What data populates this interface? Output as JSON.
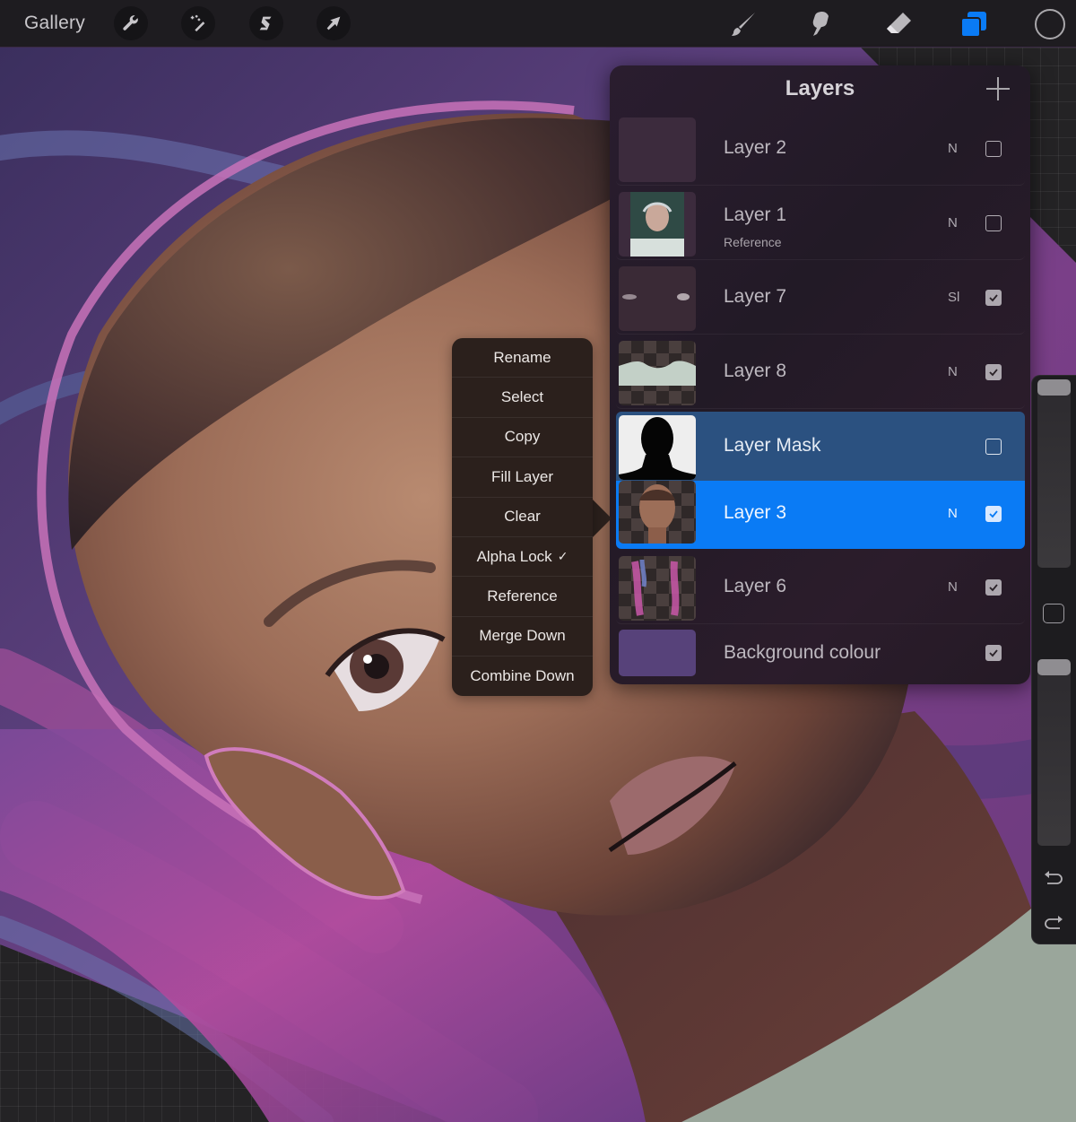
{
  "topbar": {
    "gallery_label": "Gallery",
    "left_tools": [
      {
        "name": "actions",
        "icon": "wrench-icon"
      },
      {
        "name": "adjustments",
        "icon": "magic-wand-icon"
      },
      {
        "name": "selection",
        "icon": "selection-s-icon"
      },
      {
        "name": "transform",
        "icon": "arrow-cursor-icon"
      }
    ],
    "right_tools": [
      {
        "name": "brush",
        "icon": "paintbrush-icon",
        "active": false
      },
      {
        "name": "smudge",
        "icon": "smudge-finger-icon",
        "active": false
      },
      {
        "name": "eraser",
        "icon": "eraser-icon",
        "active": false
      },
      {
        "name": "layers",
        "icon": "layers-icon",
        "active": true
      }
    ],
    "color_swatch": "#1e1c20"
  },
  "layers_panel": {
    "title": "Layers",
    "add_label": "+",
    "layers": [
      {
        "name": "Layer 2",
        "subtitle": "",
        "blend": "N",
        "visible": false,
        "thumb": "faint-face"
      },
      {
        "name": "Layer 1",
        "subtitle": "Reference",
        "blend": "N",
        "visible": false,
        "thumb": "photo"
      },
      {
        "name": "Layer 7",
        "subtitle": "",
        "blend": "Sl",
        "visible": true,
        "thumb": "highlights"
      },
      {
        "name": "Layer 8",
        "subtitle": "",
        "blend": "N",
        "visible": true,
        "thumb": "shirt"
      },
      {
        "name": "Layer Mask",
        "subtitle": "",
        "blend": "",
        "visible": false,
        "thumb": "mask"
      },
      {
        "name": "Layer 3",
        "subtitle": "",
        "blend": "N",
        "visible": true,
        "thumb": "portrait",
        "selected": true
      },
      {
        "name": "Layer 6",
        "subtitle": "",
        "blend": "N",
        "visible": true,
        "thumb": "streaks"
      },
      {
        "name": "Background colour",
        "subtitle": "",
        "blend": "",
        "visible": true,
        "thumb": "solid",
        "color": "#57427a"
      }
    ]
  },
  "context_menu": {
    "items": [
      {
        "label": "Rename",
        "checked": false
      },
      {
        "label": "Select",
        "checked": false
      },
      {
        "label": "Copy",
        "checked": false
      },
      {
        "label": "Fill Layer",
        "checked": false
      },
      {
        "label": "Clear",
        "checked": false
      },
      {
        "label": "Alpha Lock",
        "checked": true
      },
      {
        "label": "Reference",
        "checked": false
      },
      {
        "label": "Merge Down",
        "checked": false
      },
      {
        "label": "Combine Down",
        "checked": false
      }
    ],
    "check_glyph": "✓"
  },
  "sidebar": {
    "brush_size": 1.0,
    "brush_opacity": 1.0,
    "undo_icon": "undo-icon",
    "redo_icon": "redo-icon"
  },
  "colors": {
    "accent_blue": "#0a7bf5",
    "mask_row_blue": "#2b5180",
    "background_layer": "#57427a"
  }
}
